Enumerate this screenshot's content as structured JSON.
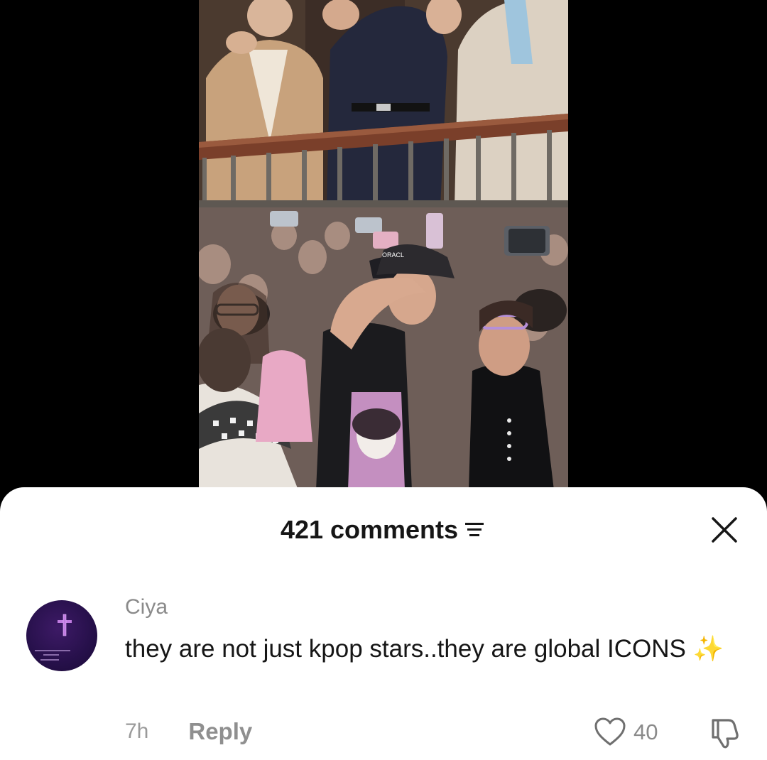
{
  "video": {
    "description_label": "",
    "shirt_print": "ORACL"
  },
  "comments_sheet": {
    "count_label": "421 comments",
    "sort_icon": "sort-lines-icon",
    "close_icon": "close-icon"
  },
  "comment": {
    "username": "Ciya",
    "text": "they are not just kpop stars..they are global ICONS ✨",
    "time": "7h",
    "reply_label": "Reply",
    "like_count": "40",
    "like_icon": "heart-outline-icon",
    "dislike_icon": "thumbs-down-icon"
  },
  "colors": {
    "sheet_bg": "#ffffff",
    "primary_text": "#161616",
    "secondary_text": "#8a8a8a",
    "avatar_bg": "#26104a"
  }
}
